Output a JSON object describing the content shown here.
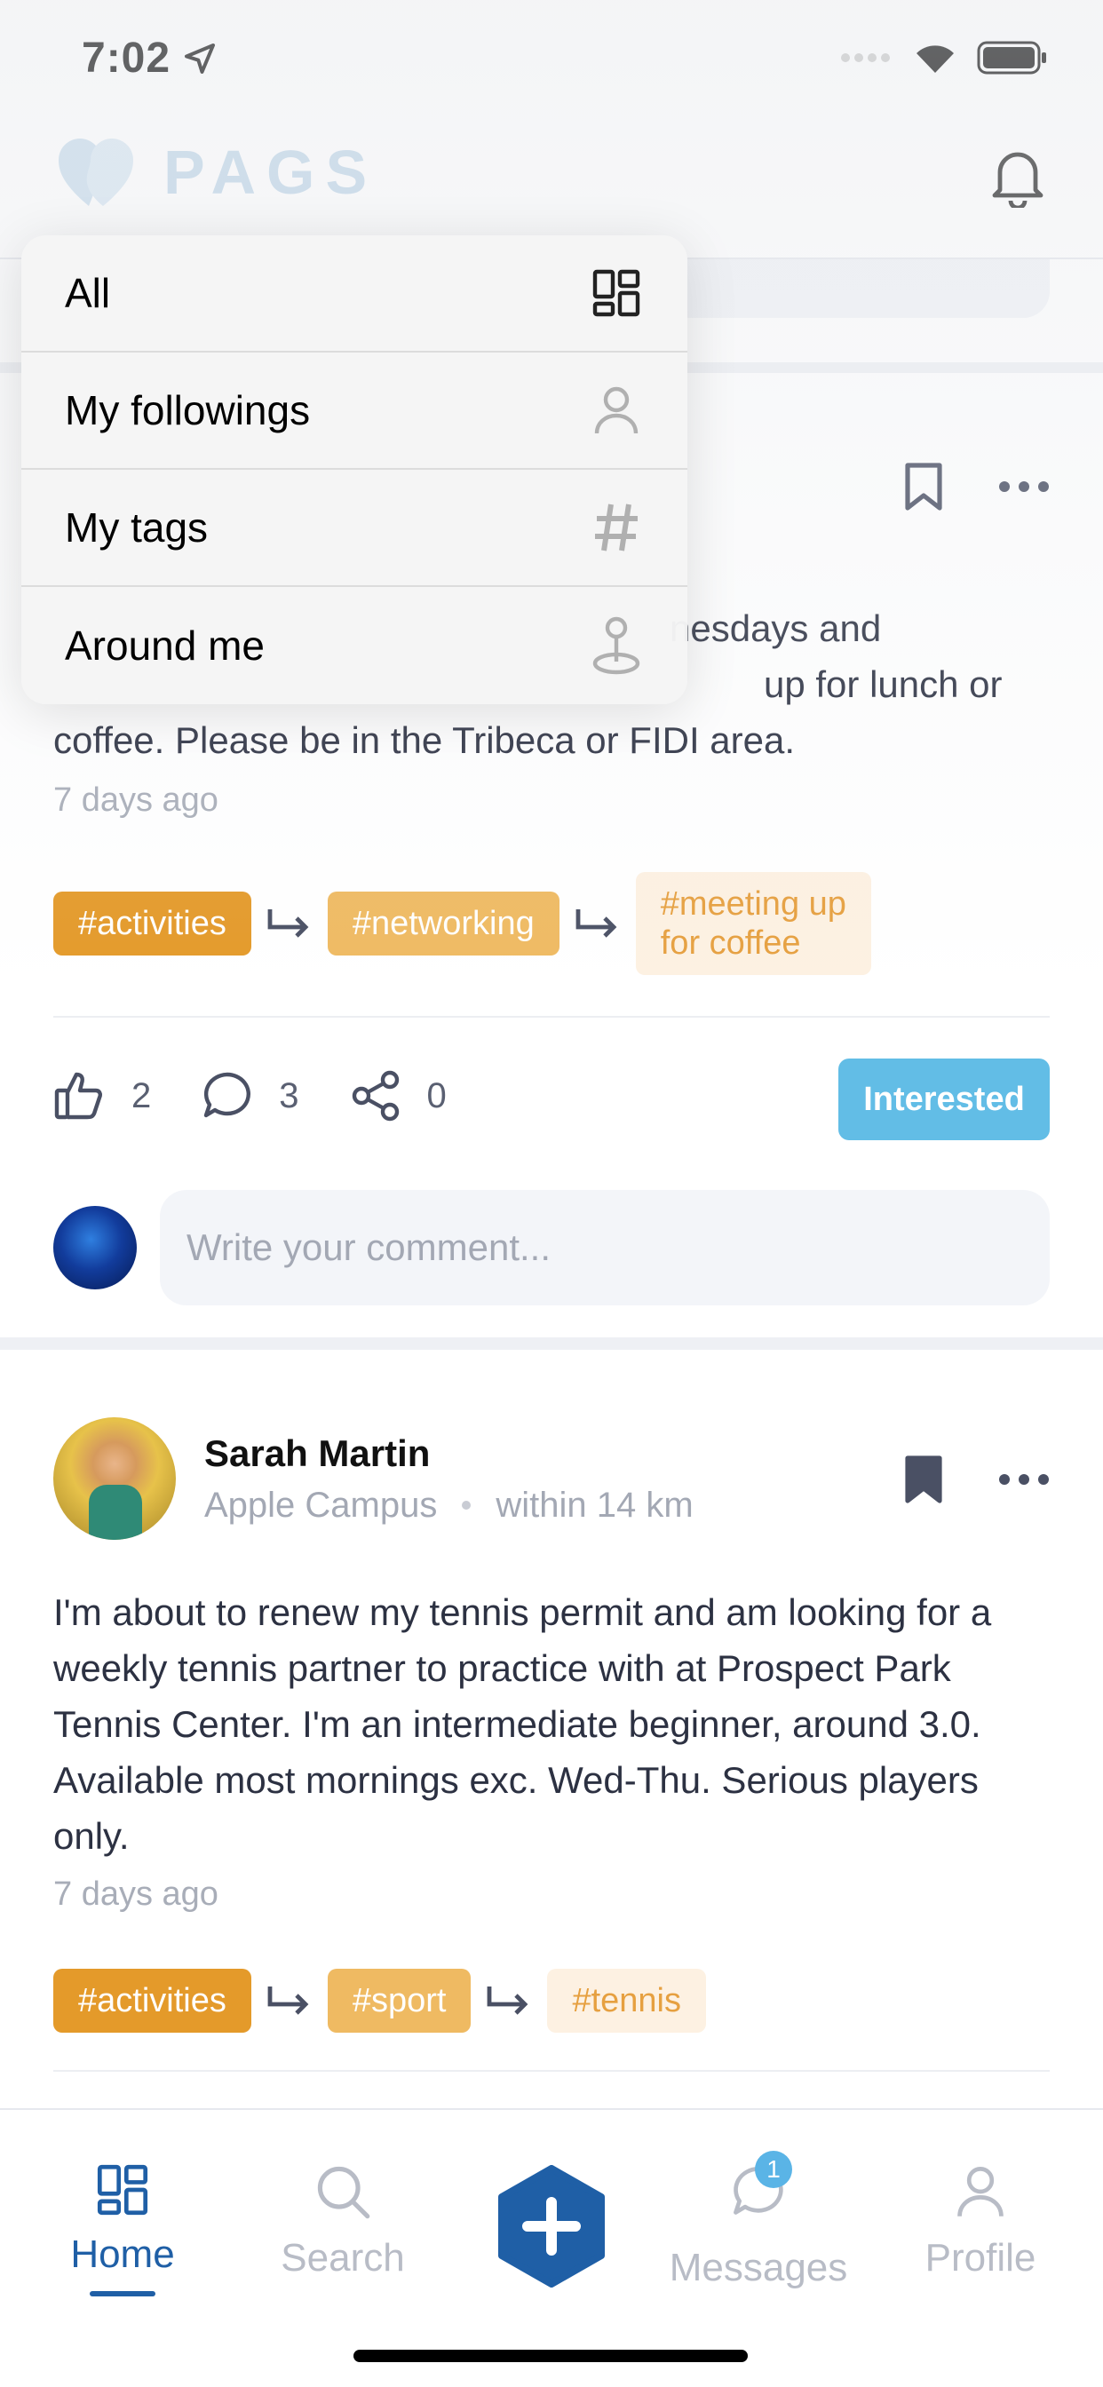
{
  "status_bar": {
    "time": "7:02"
  },
  "header": {
    "logo_text": "PAGS"
  },
  "dropdown": {
    "items": [
      {
        "label": "All",
        "icon": "grid-icon"
      },
      {
        "label": "My followings",
        "icon": "person-icon"
      },
      {
        "label": "My tags",
        "icon": "hashtag-icon"
      },
      {
        "label": "Around me",
        "icon": "location-pin-icon"
      }
    ]
  },
  "post1": {
    "body_visible_lines": [
      "nesdays and",
      "up for lunch or",
      "coffee. Please be in the Tribeca or FIDI area."
    ],
    "time": "7 days ago",
    "tags": [
      "#activities",
      "#networking",
      "#meeting up",
      "for coffee"
    ],
    "likes": "2",
    "comments": "3",
    "shares": "0",
    "interested_label": "Interested",
    "comment_placeholder": "Write your comment..."
  },
  "post2": {
    "author_name": "Sarah Martin",
    "location": "Apple Campus",
    "distance": "within 14 km",
    "body": "I'm about to renew my tennis permit and am looking for a weekly tennis partner to practice with at Prospect Park Tennis Center. I'm an intermediate beginner, around 3.0. Available most mornings exc. Wed-Thu. Serious players only.",
    "time": "7 days ago",
    "tags": [
      "#activities",
      "#sport",
      "#tennis"
    ]
  },
  "tabbar": {
    "tabs": [
      {
        "label": "Home",
        "icon": "home-grid-icon"
      },
      {
        "label": "Search",
        "icon": "search-icon"
      },
      {
        "label": "Messages",
        "icon": "message-icon",
        "badge": "1"
      },
      {
        "label": "Profile",
        "icon": "profile-icon"
      }
    ]
  },
  "colors": {
    "primary": "#1f5fa6",
    "accent_blue": "#62bde6",
    "tag_level1": "#e49a2a",
    "tag_level2": "#efba62",
    "tag_level3_bg": "#fdf1e2"
  }
}
